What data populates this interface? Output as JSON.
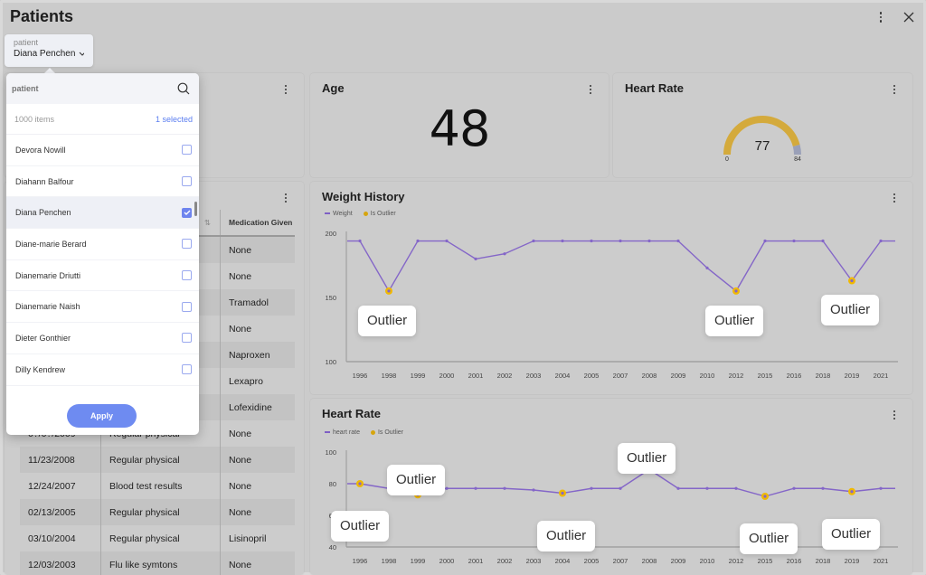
{
  "page": {
    "title": "Patients"
  },
  "filter": {
    "label": "patient",
    "value": "Diana Penchen"
  },
  "popup": {
    "search_placeholder": "patient",
    "items_count": "1000 items",
    "selected_count": "1 selected",
    "apply_label": "Apply",
    "items": [
      {
        "name": "Devora Nowill",
        "checked": false
      },
      {
        "name": "Diahann Balfour",
        "checked": false
      },
      {
        "name": "Diana Penchen",
        "checked": true
      },
      {
        "name": "Diane-marie Berard",
        "checked": false
      },
      {
        "name": "Dianemarie Driutti",
        "checked": false
      },
      {
        "name": "Dianemarie Naish",
        "checked": false
      },
      {
        "name": "Dieter Gonthier",
        "checked": false
      },
      {
        "name": "Dilly Kendrew",
        "checked": false
      }
    ]
  },
  "age_card": {
    "title": "Age",
    "value": "48"
  },
  "heart_rate_card": {
    "title": "Heart Rate",
    "value": 77,
    "min": 0,
    "max": 84,
    "gauge_colors": {
      "fill": "#d4aa3c",
      "rest": "#9aa0b8"
    }
  },
  "visits_table": {
    "headers": [
      "",
      "",
      "Medication Given"
    ],
    "rows": [
      [
        "",
        "",
        "None"
      ],
      [
        "",
        "",
        "None"
      ],
      [
        "",
        "",
        "Tramadol"
      ],
      [
        "",
        "",
        "None"
      ],
      [
        "",
        "",
        "Naproxen"
      ],
      [
        "",
        "",
        "Lexapro"
      ],
      [
        "",
        "",
        "Lofexidine"
      ],
      [
        "0?/0?/2009",
        "Regular physical",
        "None"
      ],
      [
        "11/23/2008",
        "Regular physical",
        "None"
      ],
      [
        "12/24/2007",
        "Blood test results",
        "None"
      ],
      [
        "02/13/2005",
        "Regular physical",
        "None"
      ],
      [
        "03/10/2004",
        "Regular physical",
        "Lisinopril"
      ],
      [
        "12/03/2003",
        "Flu like symtons",
        "None"
      ]
    ]
  },
  "colors": {
    "line": "#8466c8",
    "outlier": "#f0b800",
    "accent": "#6e8bf1"
  },
  "chart_data": [
    {
      "type": "line",
      "title": "Weight History",
      "categories": [
        "1996",
        "1998",
        "1999",
        "2000",
        "2001",
        "2002",
        "2003",
        "2004",
        "2005",
        "2007",
        "2008",
        "2009",
        "2010",
        "2012",
        "2015",
        "2016",
        "2018",
        "2019",
        "2021"
      ],
      "series": [
        {
          "name": "Weight",
          "values": [
            194,
            155,
            194,
            194,
            180,
            184,
            194,
            194,
            194,
            194,
            194,
            194,
            173,
            155,
            194,
            194,
            194,
            163,
            194
          ]
        }
      ],
      "outliers": [
        "1998",
        "2012",
        "2019"
      ],
      "legend": [
        "Weight",
        "Is Outlier"
      ],
      "ylim": [
        100,
        200
      ],
      "yticks": [
        100,
        150,
        200
      ],
      "callout_label": "Outlier",
      "legend_position": "top-left"
    },
    {
      "type": "line",
      "title": "Heart Rate",
      "categories": [
        "1996",
        "1998",
        "1999",
        "2000",
        "2001",
        "2002",
        "2003",
        "2004",
        "2005",
        "2007",
        "2008",
        "2009",
        "2010",
        "2012",
        "2015",
        "2016",
        "2018",
        "2019",
        "2021"
      ],
      "series": [
        {
          "name": "heart rate",
          "values": [
            80,
            77,
            73,
            77,
            77,
            77,
            76,
            74,
            77,
            77,
            89,
            77,
            77,
            77,
            72,
            77,
            77,
            75,
            77
          ]
        }
      ],
      "outliers": [
        "1996",
        "1999",
        "2004",
        "2008",
        "2015",
        "2019"
      ],
      "legend": [
        "heart rate",
        "Is Outlier"
      ],
      "ylim": [
        40,
        100
      ],
      "yticks": [
        40,
        60,
        80,
        100
      ],
      "callout_label": "Outlier",
      "legend_position": "top-left"
    }
  ]
}
